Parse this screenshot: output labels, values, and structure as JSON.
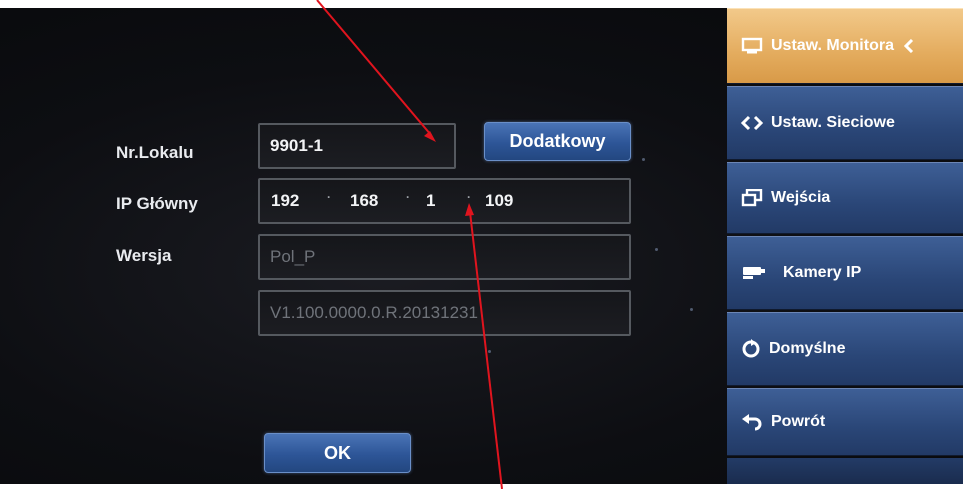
{
  "form": {
    "unit_label": "Nr.Lokalu",
    "unit_value": "9901-1",
    "extra_button": "Dodatkowy",
    "ip_label": "IP Główny",
    "ip": [
      "192",
      "168",
      "1",
      "109"
    ],
    "version_label": "Wersja",
    "version_value": "Pol_P",
    "build_value": "V1.100.0000.0.R.20131231",
    "ok_button": "OK"
  },
  "sidebar": {
    "items": [
      {
        "label": "Ustaw. Monitora",
        "icon": "monitor-icon",
        "active": true
      },
      {
        "label": "Ustaw. Sieciowe",
        "icon": "network-arrows-icon",
        "active": false
      },
      {
        "label": "Wejścia",
        "icon": "inputs-icon",
        "active": false
      },
      {
        "label": "Kamery IP",
        "icon": "camera-icon",
        "active": false
      },
      {
        "label": "Domyślne",
        "icon": "reset-icon",
        "active": false
      },
      {
        "label": "Powrót",
        "icon": "back-arrow-icon",
        "active": false
      }
    ]
  },
  "colors": {
    "accent_active": "#e4ac5e",
    "sidebar": "#2a4677",
    "button": "#2d5597",
    "annotation_arrow": "#e0141e"
  }
}
